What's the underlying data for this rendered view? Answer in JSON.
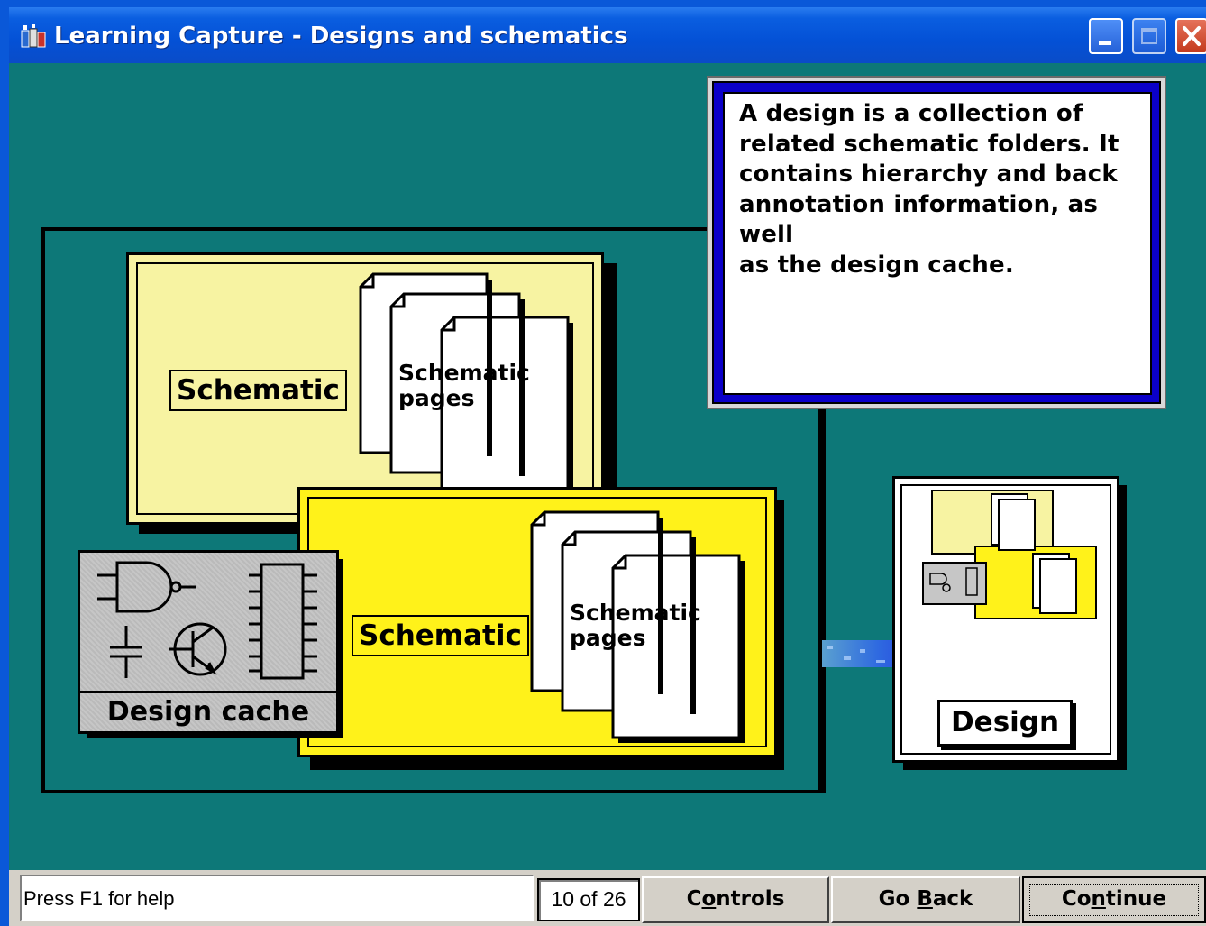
{
  "window": {
    "title": "Learning Capture - Designs and schematics",
    "icons": [
      "app-icon",
      "minimize-icon",
      "maximize-icon",
      "close-icon"
    ]
  },
  "diagram": {
    "schematic_1_label": "Schematic",
    "schematic_2_label": "Schematic",
    "pages_1_line1": "Schematic",
    "pages_1_line2": "pages",
    "pages_2_line1": "Schematic",
    "pages_2_line2": "pages",
    "design_cache_label": "Design cache",
    "design_label": "Design",
    "colors": {
      "background": "#0d7878",
      "schematic_light": "#f7f3a2",
      "schematic_bright": "#fff21a",
      "cache_gray": "#c6c6c6",
      "callout_border": "#0b00c8",
      "arrow_blue": "#1a10e0"
    }
  },
  "callout": {
    "lines": [
      "A design is a collection of",
      "related schematic folders. It",
      "contains hierarchy and back",
      "annotation information, as well",
      "as the design cache."
    ]
  },
  "statusbar": {
    "help_text": "Press F1 for help",
    "page_counter": "10 of 26",
    "controls_pre": "C",
    "controls_ul": "o",
    "controls_post": "ntrols",
    "goback_pre": "Go ",
    "goback_ul": "B",
    "goback_post": "ack",
    "continue_pre": "Co",
    "continue_ul": "n",
    "continue_post": "tinue"
  }
}
